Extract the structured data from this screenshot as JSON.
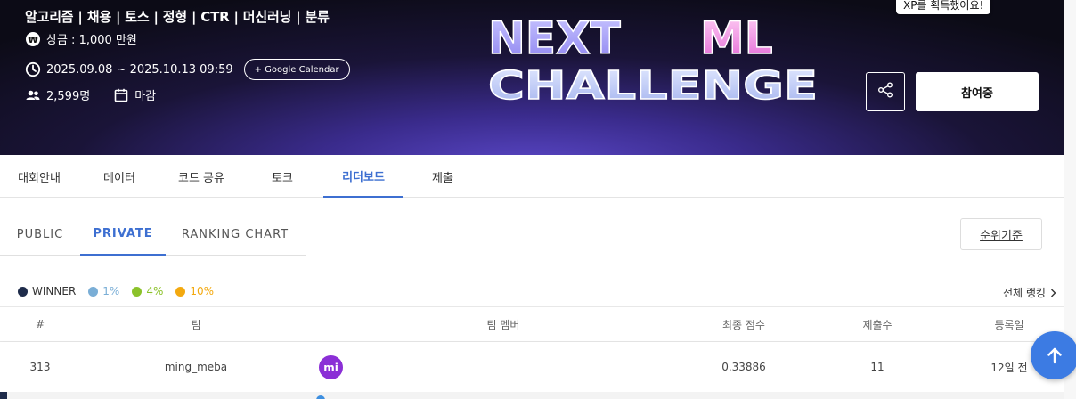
{
  "banner": {
    "title": "알고리즘 | 채용 | 토스 | 정형 | CTR | 머신러닝 | 분류",
    "prize": "상금 : 1,000 만원",
    "period": "2025.09.08 ~ 2025.10.13 09:59",
    "calendar_button": "+ Google Calendar",
    "participants": "2,599명",
    "status": "마감",
    "logo_line1": "NEXT ML",
    "logo_line2": "CHALLENGE",
    "join_button": "참여중",
    "xp_toast": "XP를 획득했어요!"
  },
  "main_tabs": [
    "대회안내",
    "데이터",
    "코드 공유",
    "토크",
    "리더보드",
    "제출"
  ],
  "active_main_tab": "리더보드",
  "sub_tabs": [
    "PUBLIC",
    "PRIVATE",
    "RANKING CHART"
  ],
  "active_sub_tab": "PRIVATE",
  "rank_criteria_button": "순위기준",
  "legend": [
    {
      "label": "WINNER",
      "color": "#1e2b4a"
    },
    {
      "label": "1%",
      "color": "#7aaed6"
    },
    {
      "label": "4%",
      "color": "#8bc22a"
    },
    {
      "label": "10%",
      "color": "#f3a90f"
    }
  ],
  "all_ranking_link": "전체 랭킹",
  "table": {
    "headers": [
      "#",
      "팀",
      "팀 멤버",
      "최종 점수",
      "제출수",
      "등록일"
    ],
    "rows": [
      {
        "rank": "313",
        "team": "ming_meba",
        "member_initials": "mi",
        "score": "0.33886",
        "submissions": "11",
        "registered": "12일 전"
      }
    ]
  },
  "colors": {
    "accent": "#3d6fd1",
    "avatar": "#8b2fd6",
    "scroll_button": "#3c7be3"
  }
}
